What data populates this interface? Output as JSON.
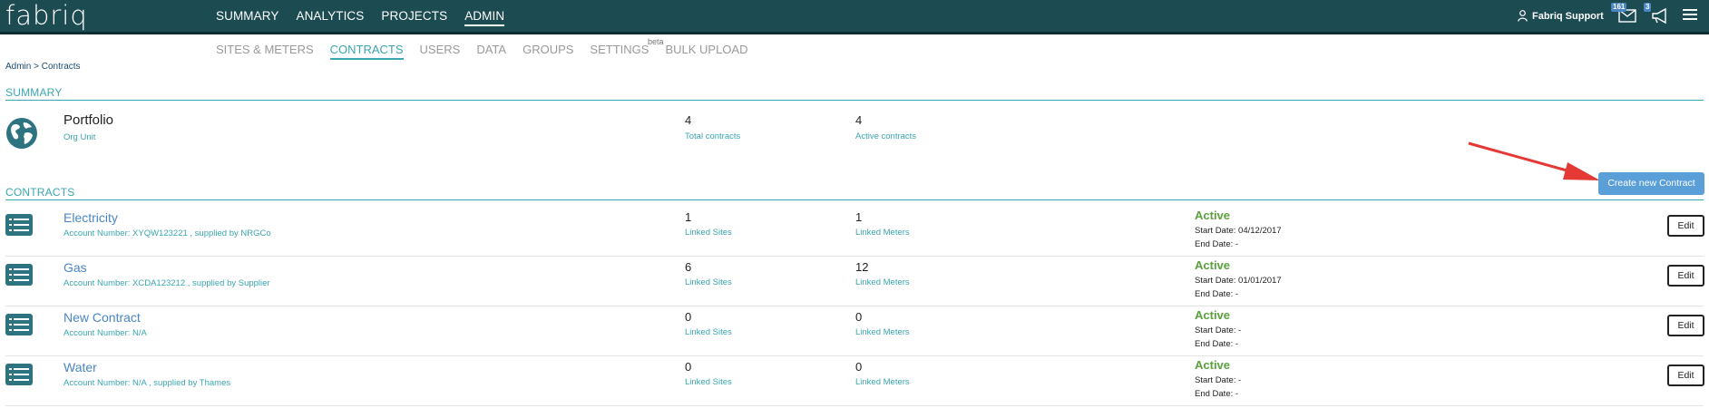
{
  "app": {
    "logo": "fabriq"
  },
  "nav": {
    "items": [
      {
        "label": "SUMMARY",
        "active": false
      },
      {
        "label": "ANALYTICS",
        "active": false
      },
      {
        "label": "PROJECTS",
        "active": false
      },
      {
        "label": "ADMIN",
        "active": true
      }
    ]
  },
  "header": {
    "user_name": "Fabriq Support",
    "messages_badge": "161",
    "announcements_badge": "3"
  },
  "subnav": {
    "items": [
      {
        "label": "SITES & METERS",
        "active": false
      },
      {
        "label": "CONTRACTS",
        "active": true
      },
      {
        "label": "USERS",
        "active": false
      },
      {
        "label": "DATA",
        "active": false
      },
      {
        "label": "GROUPS",
        "active": false
      },
      {
        "label": "SETTINGS",
        "active": false
      },
      {
        "label": "BULK UPLOAD",
        "active": false
      }
    ],
    "beta_label": "beta"
  },
  "breadcrumb": "Admin > Contracts",
  "summary": {
    "section_title": "SUMMARY",
    "name": "Portfolio",
    "type": "Org Unit",
    "total_contracts": "4",
    "total_contracts_label": "Total contracts",
    "active_contracts": "4",
    "active_contracts_label": "Active contracts"
  },
  "contracts": {
    "section_title": "CONTRACTS",
    "create_label": "Create new Contract",
    "linked_sites_label": "Linked Sites",
    "linked_meters_label": "Linked Meters",
    "edit_label": "Edit",
    "rows": [
      {
        "name": "Electricity",
        "account": "Account Number: XYQW123221 , supplied by NRGCo",
        "sites": "1",
        "meters": "1",
        "status": "Active",
        "start": "Start Date: 04/12/2017",
        "end": "End Date: -"
      },
      {
        "name": "Gas",
        "account": "Account Number: XCDA123212 , supplied by Supplier",
        "sites": "6",
        "meters": "12",
        "status": "Active",
        "start": "Start Date: 01/01/2017",
        "end": "End Date: -"
      },
      {
        "name": "New Contract",
        "account": "Account Number: N/A",
        "sites": "0",
        "meters": "0",
        "status": "Active",
        "start": "Start Date: -",
        "end": "End Date: -"
      },
      {
        "name": "Water",
        "account": "Account Number: N/A , supplied by Thames",
        "sites": "0",
        "meters": "0",
        "status": "Active",
        "start": "Start Date: -",
        "end": "End Date: -"
      }
    ]
  },
  "colors": {
    "topbar": "#1c4b52",
    "accent": "#3aa6b0",
    "link": "#4a86c6",
    "active_status": "#5aa13d",
    "button": "#5b9fd9",
    "annotation_arrow": "#e53935"
  },
  "icons": {
    "globe": "globe-icon",
    "contract": "list-icon",
    "user": "user-icon",
    "messages": "envelope-icon",
    "announcements": "megaphone-icon",
    "menu": "hamburger-icon"
  }
}
